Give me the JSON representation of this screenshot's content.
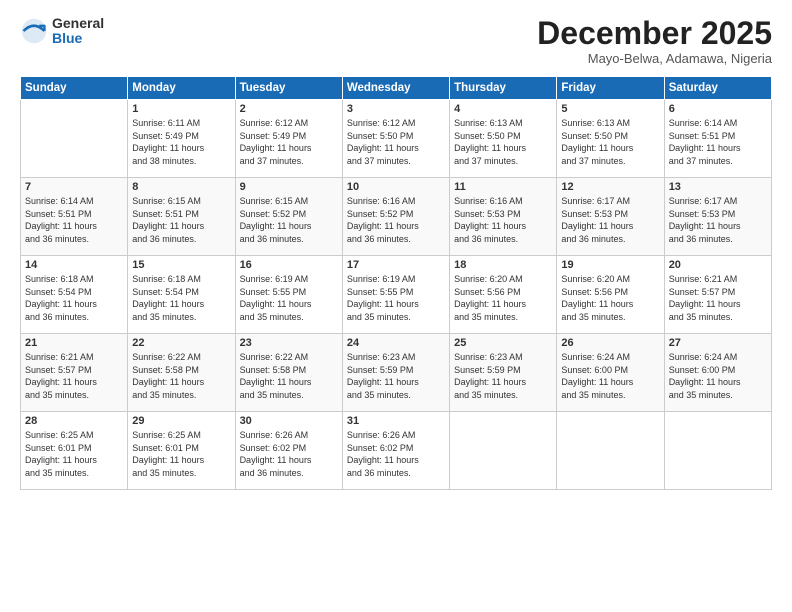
{
  "logo": {
    "general": "General",
    "blue": "Blue"
  },
  "title": "December 2025",
  "subtitle": "Mayo-Belwa, Adamawa, Nigeria",
  "days_of_week": [
    "Sunday",
    "Monday",
    "Tuesday",
    "Wednesday",
    "Thursday",
    "Friday",
    "Saturday"
  ],
  "weeks": [
    [
      {
        "day": "",
        "info": ""
      },
      {
        "day": "1",
        "info": "Sunrise: 6:11 AM\nSunset: 5:49 PM\nDaylight: 11 hours\nand 38 minutes."
      },
      {
        "day": "2",
        "info": "Sunrise: 6:12 AM\nSunset: 5:49 PM\nDaylight: 11 hours\nand 37 minutes."
      },
      {
        "day": "3",
        "info": "Sunrise: 6:12 AM\nSunset: 5:50 PM\nDaylight: 11 hours\nand 37 minutes."
      },
      {
        "day": "4",
        "info": "Sunrise: 6:13 AM\nSunset: 5:50 PM\nDaylight: 11 hours\nand 37 minutes."
      },
      {
        "day": "5",
        "info": "Sunrise: 6:13 AM\nSunset: 5:50 PM\nDaylight: 11 hours\nand 37 minutes."
      },
      {
        "day": "6",
        "info": "Sunrise: 6:14 AM\nSunset: 5:51 PM\nDaylight: 11 hours\nand 37 minutes."
      }
    ],
    [
      {
        "day": "7",
        "info": "Sunrise: 6:14 AM\nSunset: 5:51 PM\nDaylight: 11 hours\nand 36 minutes."
      },
      {
        "day": "8",
        "info": "Sunrise: 6:15 AM\nSunset: 5:51 PM\nDaylight: 11 hours\nand 36 minutes."
      },
      {
        "day": "9",
        "info": "Sunrise: 6:15 AM\nSunset: 5:52 PM\nDaylight: 11 hours\nand 36 minutes."
      },
      {
        "day": "10",
        "info": "Sunrise: 6:16 AM\nSunset: 5:52 PM\nDaylight: 11 hours\nand 36 minutes."
      },
      {
        "day": "11",
        "info": "Sunrise: 6:16 AM\nSunset: 5:53 PM\nDaylight: 11 hours\nand 36 minutes."
      },
      {
        "day": "12",
        "info": "Sunrise: 6:17 AM\nSunset: 5:53 PM\nDaylight: 11 hours\nand 36 minutes."
      },
      {
        "day": "13",
        "info": "Sunrise: 6:17 AM\nSunset: 5:53 PM\nDaylight: 11 hours\nand 36 minutes."
      }
    ],
    [
      {
        "day": "14",
        "info": "Sunrise: 6:18 AM\nSunset: 5:54 PM\nDaylight: 11 hours\nand 36 minutes."
      },
      {
        "day": "15",
        "info": "Sunrise: 6:18 AM\nSunset: 5:54 PM\nDaylight: 11 hours\nand 35 minutes."
      },
      {
        "day": "16",
        "info": "Sunrise: 6:19 AM\nSunset: 5:55 PM\nDaylight: 11 hours\nand 35 minutes."
      },
      {
        "day": "17",
        "info": "Sunrise: 6:19 AM\nSunset: 5:55 PM\nDaylight: 11 hours\nand 35 minutes."
      },
      {
        "day": "18",
        "info": "Sunrise: 6:20 AM\nSunset: 5:56 PM\nDaylight: 11 hours\nand 35 minutes."
      },
      {
        "day": "19",
        "info": "Sunrise: 6:20 AM\nSunset: 5:56 PM\nDaylight: 11 hours\nand 35 minutes."
      },
      {
        "day": "20",
        "info": "Sunrise: 6:21 AM\nSunset: 5:57 PM\nDaylight: 11 hours\nand 35 minutes."
      }
    ],
    [
      {
        "day": "21",
        "info": "Sunrise: 6:21 AM\nSunset: 5:57 PM\nDaylight: 11 hours\nand 35 minutes."
      },
      {
        "day": "22",
        "info": "Sunrise: 6:22 AM\nSunset: 5:58 PM\nDaylight: 11 hours\nand 35 minutes."
      },
      {
        "day": "23",
        "info": "Sunrise: 6:22 AM\nSunset: 5:58 PM\nDaylight: 11 hours\nand 35 minutes."
      },
      {
        "day": "24",
        "info": "Sunrise: 6:23 AM\nSunset: 5:59 PM\nDaylight: 11 hours\nand 35 minutes."
      },
      {
        "day": "25",
        "info": "Sunrise: 6:23 AM\nSunset: 5:59 PM\nDaylight: 11 hours\nand 35 minutes."
      },
      {
        "day": "26",
        "info": "Sunrise: 6:24 AM\nSunset: 6:00 PM\nDaylight: 11 hours\nand 35 minutes."
      },
      {
        "day": "27",
        "info": "Sunrise: 6:24 AM\nSunset: 6:00 PM\nDaylight: 11 hours\nand 35 minutes."
      }
    ],
    [
      {
        "day": "28",
        "info": "Sunrise: 6:25 AM\nSunset: 6:01 PM\nDaylight: 11 hours\nand 35 minutes."
      },
      {
        "day": "29",
        "info": "Sunrise: 6:25 AM\nSunset: 6:01 PM\nDaylight: 11 hours\nand 35 minutes."
      },
      {
        "day": "30",
        "info": "Sunrise: 6:26 AM\nSunset: 6:02 PM\nDaylight: 11 hours\nand 36 minutes."
      },
      {
        "day": "31",
        "info": "Sunrise: 6:26 AM\nSunset: 6:02 PM\nDaylight: 11 hours\nand 36 minutes."
      },
      {
        "day": "",
        "info": ""
      },
      {
        "day": "",
        "info": ""
      },
      {
        "day": "",
        "info": ""
      }
    ]
  ]
}
